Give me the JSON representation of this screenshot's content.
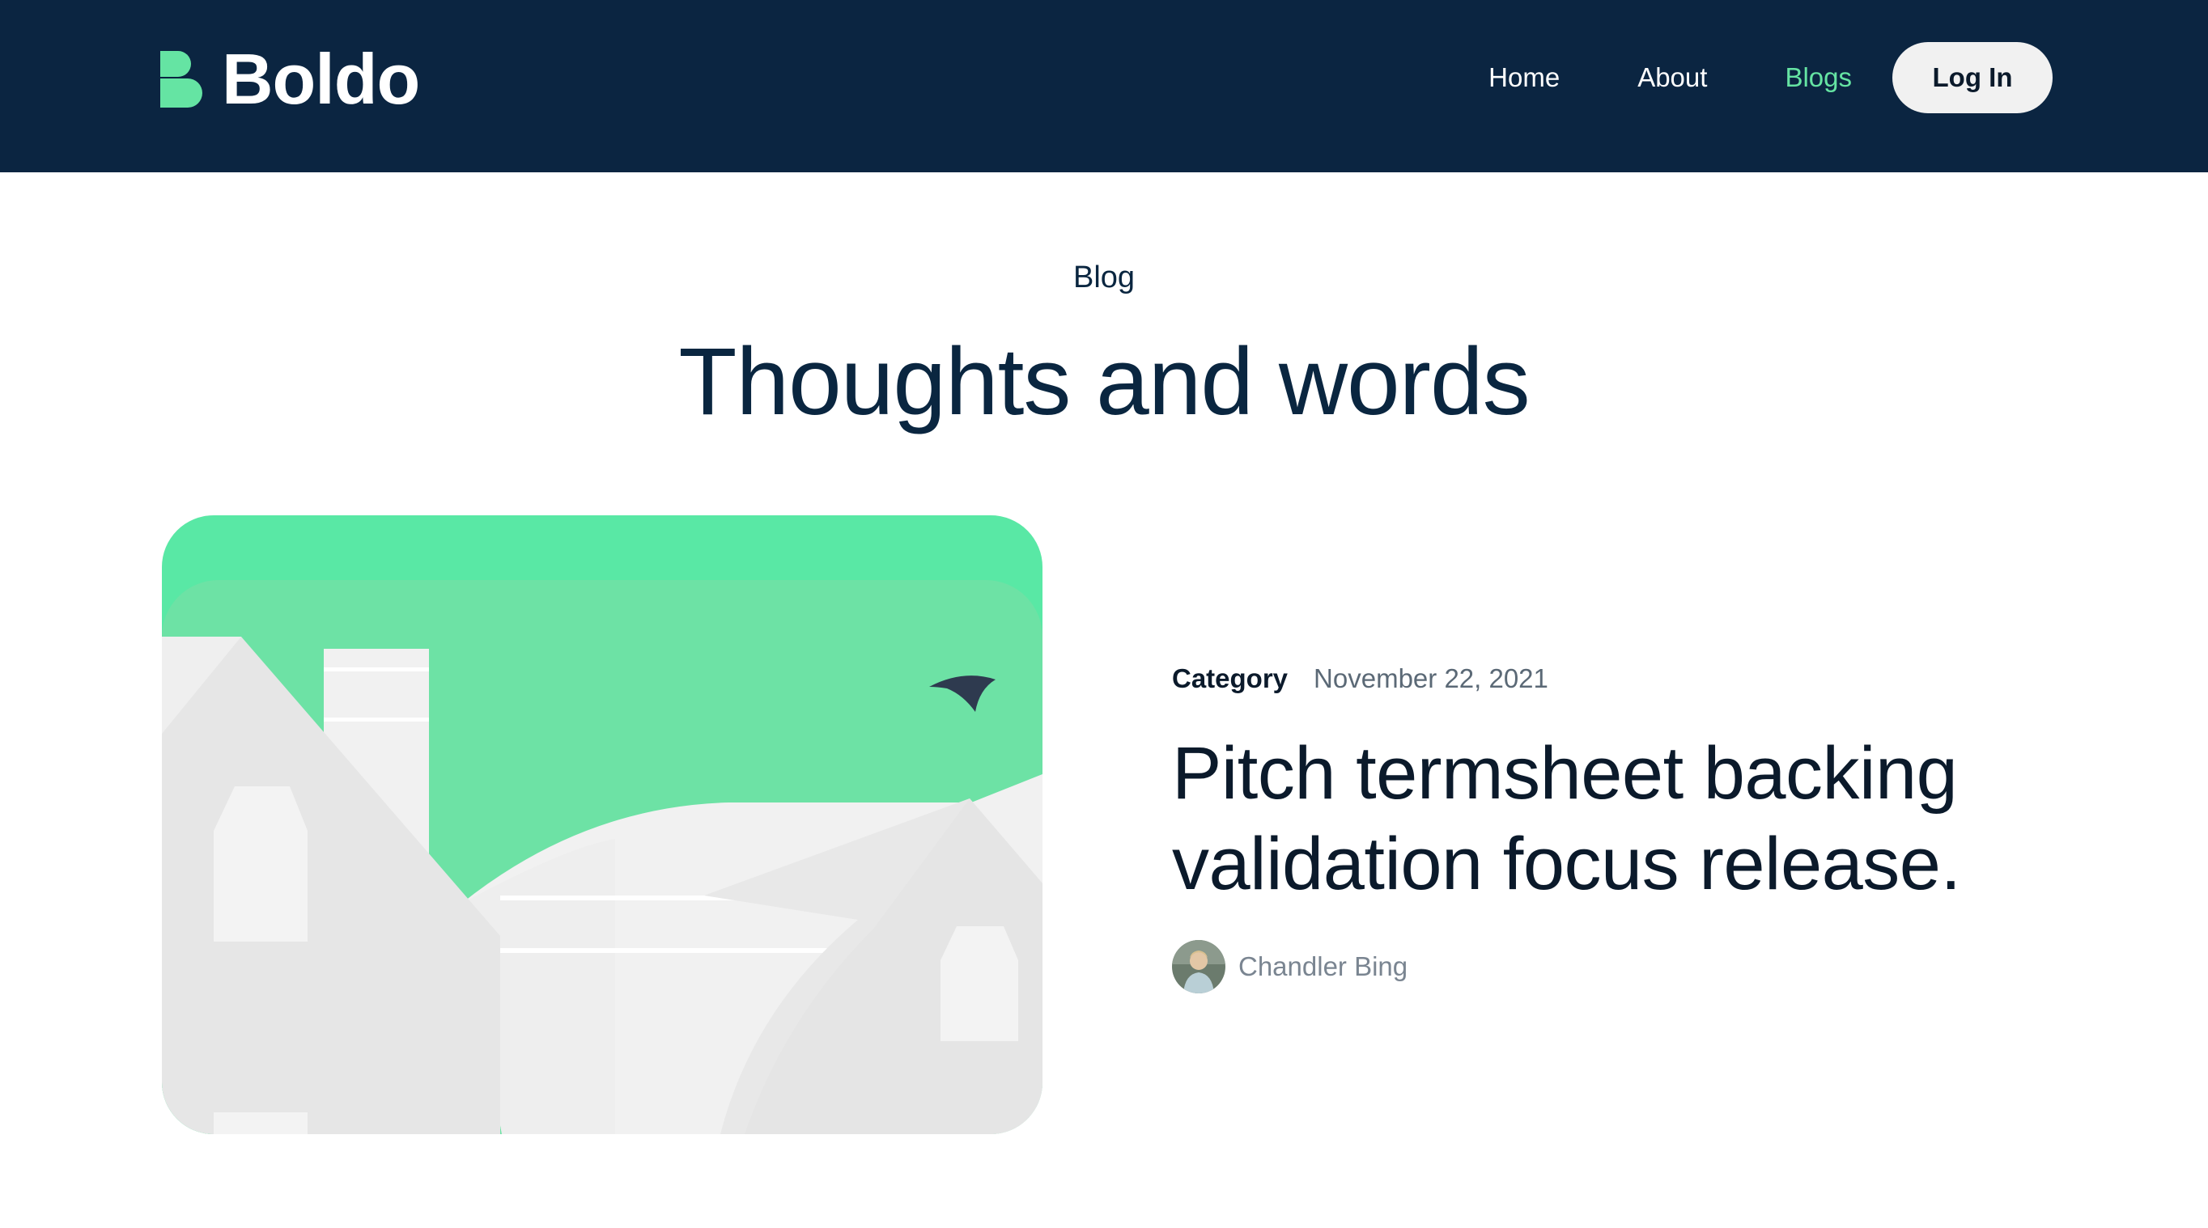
{
  "brand": {
    "name": "Boldo",
    "accent": "#65e4a3",
    "header_bg": "#0b2541"
  },
  "nav": {
    "items": [
      {
        "label": "Home",
        "active": false
      },
      {
        "label": "About",
        "active": false
      },
      {
        "label": "Blogs",
        "active": true
      }
    ],
    "login_label": "Log In"
  },
  "hero": {
    "eyebrow": "Blog",
    "title": "Thoughts and words"
  },
  "post": {
    "category": "Category",
    "date": "November 22, 2021",
    "title": "Pitch termsheet backing validation focus release.",
    "author": "Chandler Bing",
    "image_icon": "illustration-houses-bird",
    "avatar_icon": "author-avatar"
  }
}
